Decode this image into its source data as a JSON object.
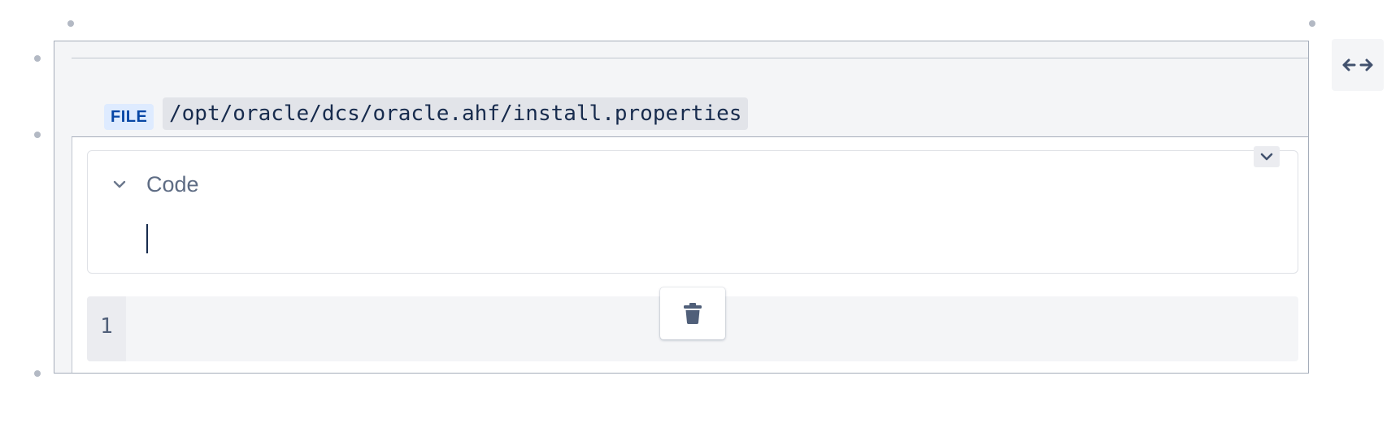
{
  "table": {
    "header": {
      "file_label": "FILE",
      "file_path": "/opt/oracle/dcs/oracle.ahf/install.properties"
    },
    "code_panel": {
      "title": "Code",
      "toggle_icon": "chevron-down-icon",
      "expand_icon": "chevron-down-icon"
    },
    "code_block": {
      "line_numbers": [
        "1"
      ]
    }
  },
  "floating_toolbar": {
    "delete_icon": "trash-icon"
  },
  "side_controls": {
    "layout_icon": "arrows-horizontal-icon"
  },
  "colors": {
    "file_label_bg": "#deebff",
    "file_label_text": "#0747a6",
    "border": "#a5adba",
    "cell_bg": "#f4f5f7"
  }
}
